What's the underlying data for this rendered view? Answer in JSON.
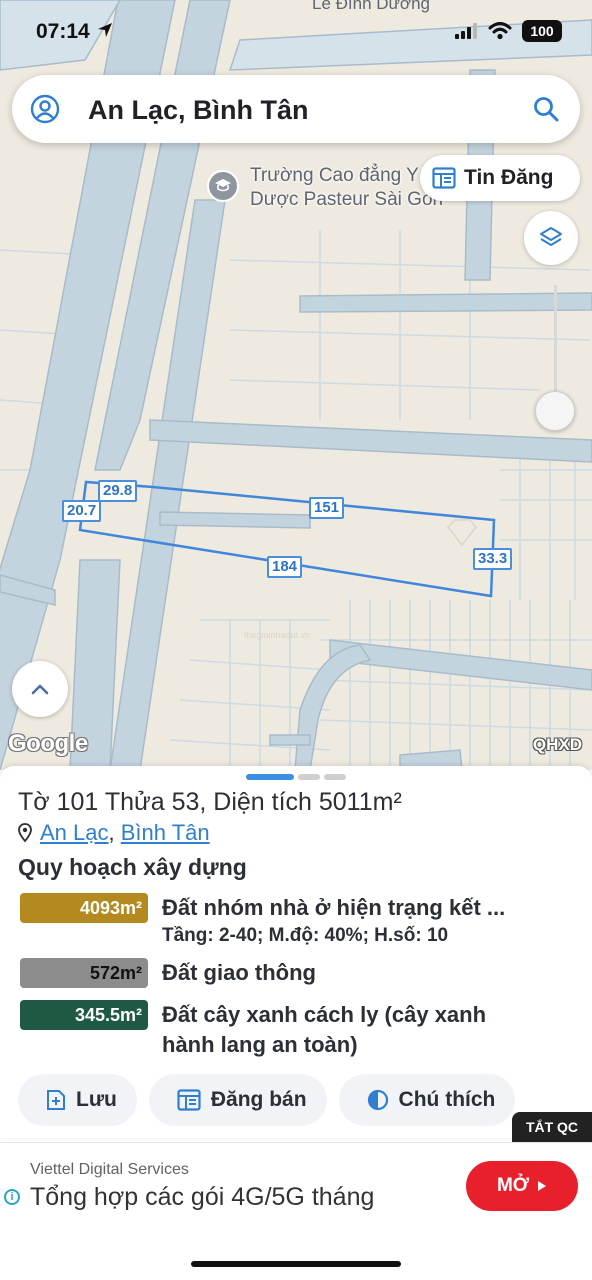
{
  "status_bar": {
    "time": "07:14",
    "battery": "100"
  },
  "map": {
    "top_street_label": "Lê Đình Dương",
    "search": {
      "query": "An Lạc, Bình Tân"
    },
    "poi": {
      "name_line1": "Trường Cao đẳng Y",
      "name_line2": "Dược Pasteur Sài Gòn"
    },
    "tin_dang_label": "Tin Đăng",
    "parcel_dimensions": {
      "top_left": "29.8",
      "left": "20.7",
      "top": "151",
      "bottom": "184",
      "right": "33.3"
    },
    "google_label": "Google",
    "layer_code": "QHXD",
    "colors": {
      "land": "#efeadf",
      "road": "#c3d4df",
      "road_edge": "#9fb6c7",
      "parcel_line": "#b8cfe0",
      "boundary": "#3f87dc"
    }
  },
  "sheet": {
    "title": "Tờ 101 Thửa 53, Diện tích 5011m²",
    "location": {
      "ward": "An Lạc",
      "separator": ",",
      "district": "Bình Tân"
    },
    "section_title": "Quy hoạch xây dựng",
    "zones": [
      {
        "area": "4093m²",
        "name": "Đất nhóm nhà ở hiện trạng kết ...",
        "details": "Tầng: 2-40; M.độ: 40%; H.số: 10",
        "color": "#b48a1e"
      },
      {
        "area": "572m²",
        "name": "Đất giao thông",
        "color": "#8c8c8c"
      },
      {
        "area": "345.5m²",
        "name": "Đất cây xanh cách ly (cây xanh",
        "name_line2": "hành lang an toàn)",
        "color": "#1e5a43"
      }
    ],
    "actions": {
      "save": "Lưu",
      "post": "Đăng bán",
      "legend": "Chú thích"
    },
    "close_ads": "TẮT QC"
  },
  "ad": {
    "sponsor": "Viettel Digital Services",
    "headline": "Tổng hợp các gói 4G/5G tháng",
    "cta": "MỞ",
    "cta_color": "#e8202c"
  }
}
